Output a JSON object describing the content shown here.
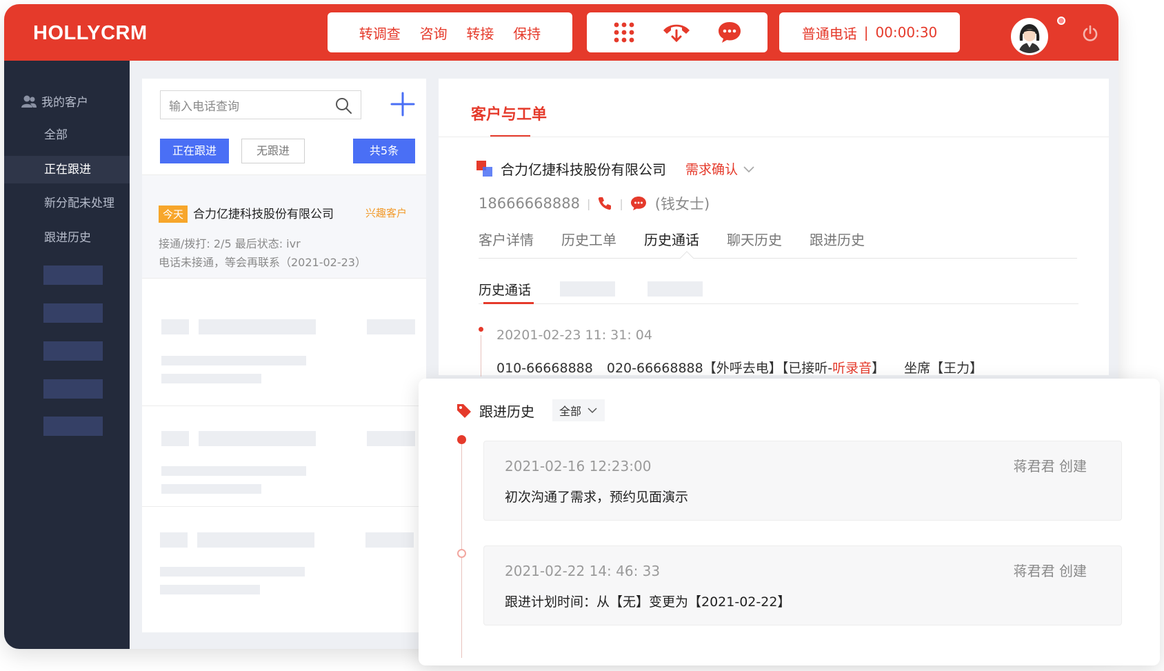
{
  "header": {
    "logo": "HOLLYCRM",
    "actions": [
      "转调查",
      "咨询",
      "转接",
      "保持"
    ],
    "tools": [
      "dialpad-icon",
      "hangup-icon",
      "chat-icon"
    ],
    "call_type": "普通电话",
    "separator": "|",
    "call_timer": "00:00:30"
  },
  "sidebar": {
    "heading": "我的客户",
    "items": [
      "全部",
      "正在跟进",
      "新分配未处理",
      "跟进历史"
    ],
    "active_index": 1
  },
  "list": {
    "search_placeholder": "输入电话查询",
    "btn_following": "正在跟进",
    "btn_nofollow": "无跟进",
    "btn_count": "共5条",
    "card": {
      "tag": "今天",
      "company": "合力亿捷科技股份有限公司",
      "interest": "兴趣客户",
      "stats": "接通/拨打:  2/5    最后状态:  ivr",
      "note": "电话未接通，等会再联系（2021-02-23）"
    }
  },
  "detail": {
    "title": "客户与工单",
    "company": "合力亿捷科技股份有限公司",
    "status": "需求确认",
    "phone": "18666668888",
    "contact": "(钱女士)",
    "tabs": [
      "客户详情",
      "历史工单",
      "历史通话",
      "聊天历史",
      "跟进历史"
    ],
    "active_tab": 2,
    "inner_tab": "历史通话",
    "call": {
      "time": "20201-02-23 11: 31: 04",
      "from": "010-66668888",
      "to": "020-66668888",
      "desc_a": "【外呼去电】【已接听-",
      "desc_link": "听录音",
      "desc_b": "】",
      "agent": "坐席【王力】"
    }
  },
  "follow": {
    "title": "跟进历史",
    "filter": "全部",
    "entries": [
      {
        "time": "2021-02-16 12:23:00",
        "by": "蒋君君 创建",
        "content": "初次沟通了需求，预约见面演示"
      },
      {
        "time": "2021-02-22 14: 46: 33",
        "by": "蒋君君 创建",
        "content": "跟进计划时间：从【无】变更为【2021-02-22】"
      }
    ]
  },
  "colors": {
    "brand_red": "#e53a2b",
    "primary_blue": "#4a6ff5",
    "sidebar_bg": "#232a3b",
    "tag_orange": "#f7a62b"
  }
}
